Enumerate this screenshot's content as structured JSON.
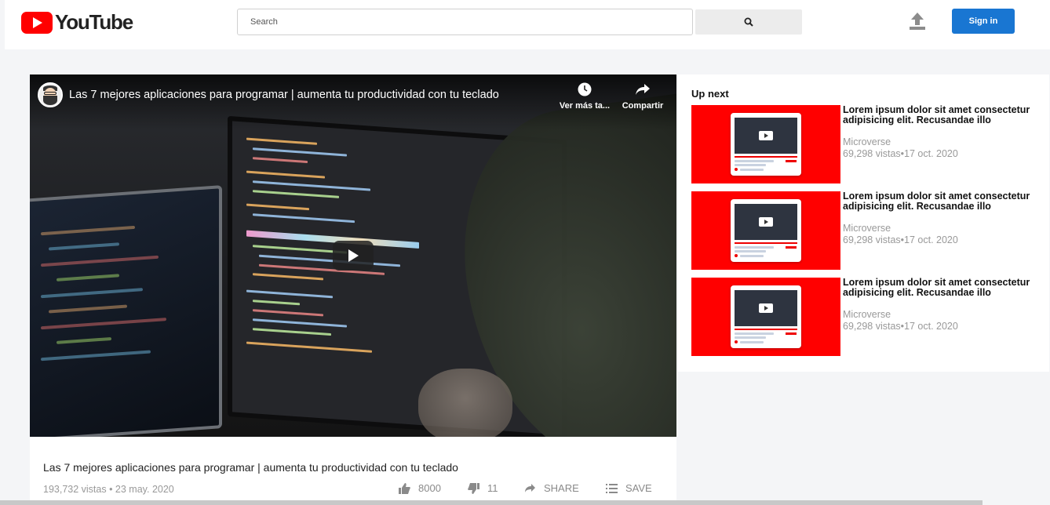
{
  "header": {
    "logo_text": "YouTube",
    "search_placeholder": "Search",
    "signin_label": "Sign in"
  },
  "player": {
    "title": "Las 7 mejores aplicaciones para programar | aumenta tu productividad con tu teclado",
    "watch_later_label": "Ver más ta...",
    "share_label": "Compartir"
  },
  "video_info": {
    "title": "Las 7 mejores aplicaciones para programar | aumenta tu productividad con tu teclado",
    "meta": "193,732 vistas • 23 may. 2020",
    "likes": "8000",
    "dislikes": "11",
    "share_label": "SHARE",
    "save_label": "SAVE"
  },
  "upnext": {
    "heading": "Up next",
    "items": [
      {
        "title": "Lorem ipsum dolor sit amet consectetur adipisicing elit. Recusandae illo",
        "channel": "Microverse",
        "stats": "69,298 vistas•17 oct. 2020"
      },
      {
        "title": "Lorem ipsum dolor sit amet consectetur adipisicing elit. Recusandae illo",
        "channel": "Microverse",
        "stats": "69,298 vistas•17 oct. 2020"
      },
      {
        "title": "Lorem ipsum dolor sit amet consectetur adipisicing elit. Recusandae illo",
        "channel": "Microverse",
        "stats": "69,298 vistas•17 oct. 2020"
      }
    ]
  },
  "colors": {
    "brand_red": "#ff0000",
    "signin_blue": "#1976d2"
  }
}
